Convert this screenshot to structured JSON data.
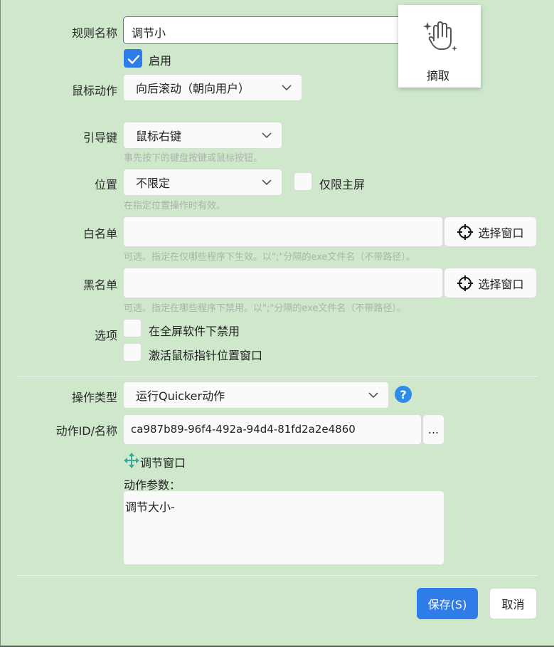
{
  "form": {
    "rule_name_label": "规则名称",
    "rule_name_value": "调节小",
    "enable_label": "启用",
    "enabled": true,
    "mouse_action_label": "鼠标动作",
    "mouse_action_value": "向后滚动（朝向用户）",
    "lead_key_label": "引导键",
    "lead_key_value": "鼠标右键",
    "lead_key_hint": "事先按下的键盘按键或鼠标按钮。",
    "position_label": "位置",
    "position_value": "不限定",
    "main_screen_only_label": "仅限主屏",
    "position_hint": "在指定位置操作时有效。",
    "whitelist_label": "白名单",
    "whitelist_value": "",
    "whitelist_hint": "可选。指定在仅哪些程序下生效。以\";\"分隔的exe文件名（不带路径）。",
    "blacklist_label": "黑名单",
    "blacklist_value": "",
    "blacklist_hint": "可选。指定在哪些程序下禁用。以\";\"分隔的exe文件名（不带路径）。",
    "select_window_label": "选择窗口",
    "options_label": "选项",
    "option_fullscreen_label": "在全屏软件下禁用",
    "option_activate_label": "激活鼠标指针位置窗口",
    "action_type_label": "操作类型",
    "action_type_value": "运行Quicker动作",
    "action_id_label": "动作ID/名称",
    "action_id_value": "ca987b89-96f4-492a-94d4-81fd2a2e4860",
    "more_button_label": "...",
    "action_link_label": "调节窗口",
    "action_params_label": "动作参数：",
    "action_params_value": "调节大小-"
  },
  "popup": {
    "extract_label": "摘取",
    "icon": "hand-sparkle-icon"
  },
  "footer": {
    "save_label": "保存(S)",
    "cancel_label": "取消"
  },
  "colors": {
    "background": "#cfe8cc",
    "accent": "#2f7be8",
    "help": "#2f8be8",
    "link_icon": "#3aa89a"
  }
}
